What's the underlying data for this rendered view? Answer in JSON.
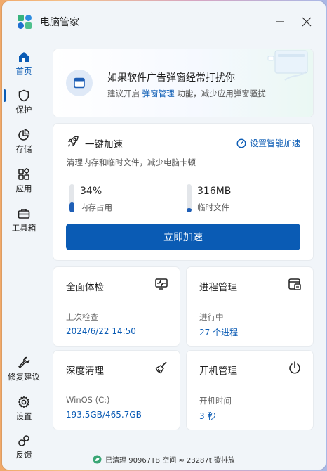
{
  "app": {
    "title": "电脑管家"
  },
  "colors": {
    "accent": "#0a5bb4",
    "window_bg": "#f1f5f9",
    "card_bg": "#ffffff"
  },
  "sidebar": {
    "items": [
      {
        "label": "首页",
        "icon": "home-icon",
        "active": true
      },
      {
        "label": "保护",
        "icon": "shield-icon"
      },
      {
        "label": "存储",
        "icon": "pie-chart-icon"
      },
      {
        "label": "应用",
        "icon": "apps-icon"
      },
      {
        "label": "工具箱",
        "icon": "toolbox-icon"
      }
    ],
    "bottom_items": [
      {
        "label": "修复建议",
        "icon": "wrench-icon"
      },
      {
        "label": "设置",
        "icon": "gear-icon"
      },
      {
        "label": "反馈",
        "icon": "feedback-icon"
      }
    ]
  },
  "banner": {
    "title": "如果软件广告弹窗经常打扰你",
    "desc_prefix": "建议开启",
    "desc_link": "弹窗管理",
    "desc_suffix": "功能，减少应用弹窗骚扰"
  },
  "boost": {
    "title": "一键加速",
    "smart_link": "设置智能加速",
    "desc": "清理内存和临时文件，减少电脑卡顿",
    "memory": {
      "value": "34%",
      "label": "内存占用",
      "level": 0.34
    },
    "temp": {
      "value": "316MB",
      "label": "临时文件",
      "level": 0.15
    },
    "button": "立即加速"
  },
  "tiles": [
    {
      "title": "全面体检",
      "icon": "monitor-pulse-icon",
      "sub": "上次检查",
      "value": "2024/6/22 14:50"
    },
    {
      "title": "进程管理",
      "icon": "process-window-icon",
      "sub": "进行中",
      "value": "27 个进程"
    },
    {
      "title": "深度清理",
      "icon": "broom-icon",
      "sub": "WinOS (C:)",
      "value": "193.5GB/465.7GB"
    },
    {
      "title": "开机管理",
      "icon": "power-icon",
      "sub": "开机时间",
      "value": "3 秒"
    }
  ],
  "footer": {
    "text": "已清理 90967TB 空间 ≈ 23287t 碳排放"
  }
}
